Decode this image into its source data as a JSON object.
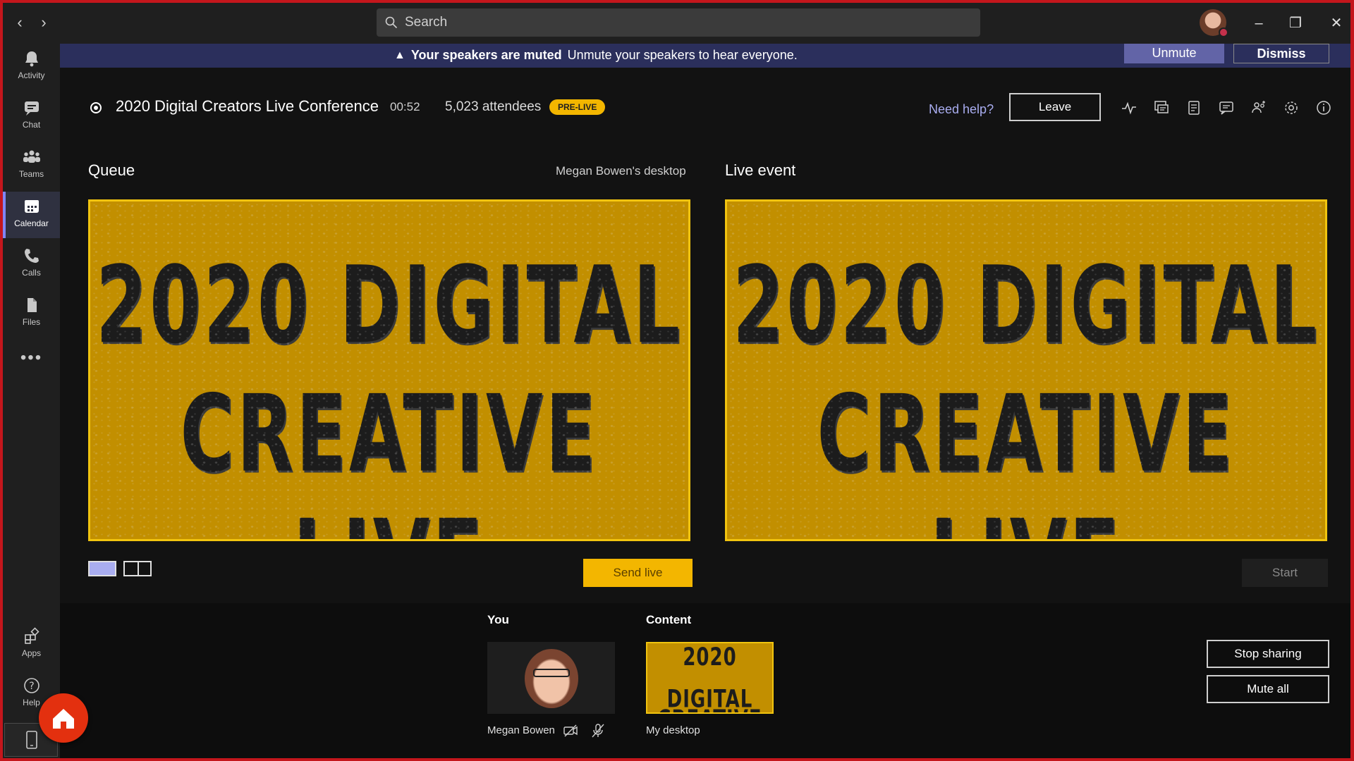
{
  "titlebar": {
    "search_placeholder": "Search",
    "icons": [
      "back-arrow-icon",
      "forward-arrow-icon",
      "search-icon",
      "minimize-icon",
      "maximize-icon",
      "close-icon"
    ]
  },
  "rail": {
    "items": [
      {
        "label": "Activity",
        "icon": "bell-icon"
      },
      {
        "label": "Chat",
        "icon": "chat-icon"
      },
      {
        "label": "Teams",
        "icon": "teams-icon"
      },
      {
        "label": "Calendar",
        "icon": "calendar-icon",
        "active": true
      },
      {
        "label": "Calls",
        "icon": "phone-icon"
      },
      {
        "label": "Files",
        "icon": "files-icon"
      }
    ],
    "more": "•••",
    "apps": "Apps",
    "help": "Help"
  },
  "banner": {
    "bold": "Your speakers are muted",
    "text": "Unmute your speakers to hear everyone.",
    "unmute": "Unmute",
    "dismiss": "Dismiss"
  },
  "event": {
    "title": "2020 Digital Creators Live Conference",
    "time": "00:52",
    "attendees": "5,023 attendees",
    "badge": "PRE-LIVE",
    "help": "Need help?",
    "leave": "Leave"
  },
  "queue": {
    "label": "Queue",
    "source": "Megan Bowen's desktop",
    "slide_line1": "2020 DIGITAL",
    "slide_line2": "CREATIVE LIVE",
    "send": "Send live"
  },
  "live": {
    "label": "Live event",
    "slide_line1": "2020 DIGITAL",
    "slide_line2": "CREATIVE LIVE",
    "start": "Start"
  },
  "tray": {
    "you_label": "You",
    "you_name": "Megan Bowen",
    "content_label": "Content",
    "content_line1": "2020 DIGITAL",
    "content_line2": "CREATIVE LIVE",
    "content_name": "My desktop",
    "stop_sharing": "Stop sharing",
    "mute_all": "Mute all"
  },
  "colors": {
    "accent": "#6264a7",
    "banner": "#2b2f5c",
    "slide": "#c28f00",
    "badge": "#f3b600",
    "window_border": "#c4161c",
    "home": "#e3300f"
  }
}
